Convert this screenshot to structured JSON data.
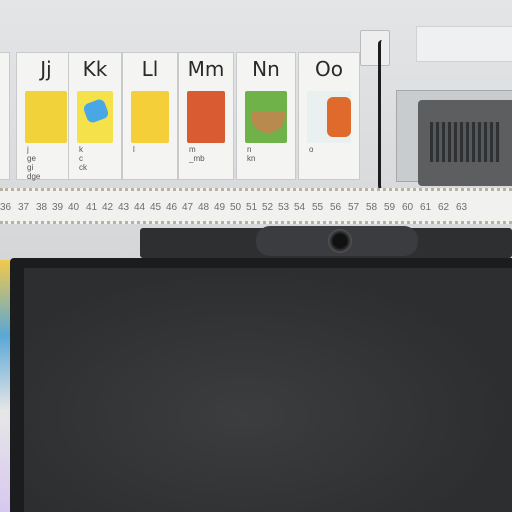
{
  "alphabet_cards": [
    {
      "letters": "Jj",
      "words": "j\nge\ngi\ndge",
      "color": "#f2d23a"
    },
    {
      "letters": "Kk",
      "words": "k\nc\nck",
      "color": "#f5e24a"
    },
    {
      "letters": "Ll",
      "words": "l",
      "color": "#f4cf3a"
    },
    {
      "letters": "Mm",
      "words": "m\n_mb",
      "color": "#d95b32"
    },
    {
      "letters": "Nn",
      "words": "n\nkn",
      "color": "#6fb24a"
    },
    {
      "letters": "Oo",
      "words": "o",
      "color": "#d0e7c9"
    }
  ],
  "number_line": [
    "36",
    "37",
    "38",
    "39",
    "40",
    "41",
    "42",
    "43",
    "44",
    "45",
    "46",
    "47",
    "48",
    "49",
    "50",
    "51",
    "52",
    "53",
    "54",
    "55",
    "56",
    "57",
    "58",
    "59",
    "60",
    "61",
    "62",
    "63"
  ]
}
